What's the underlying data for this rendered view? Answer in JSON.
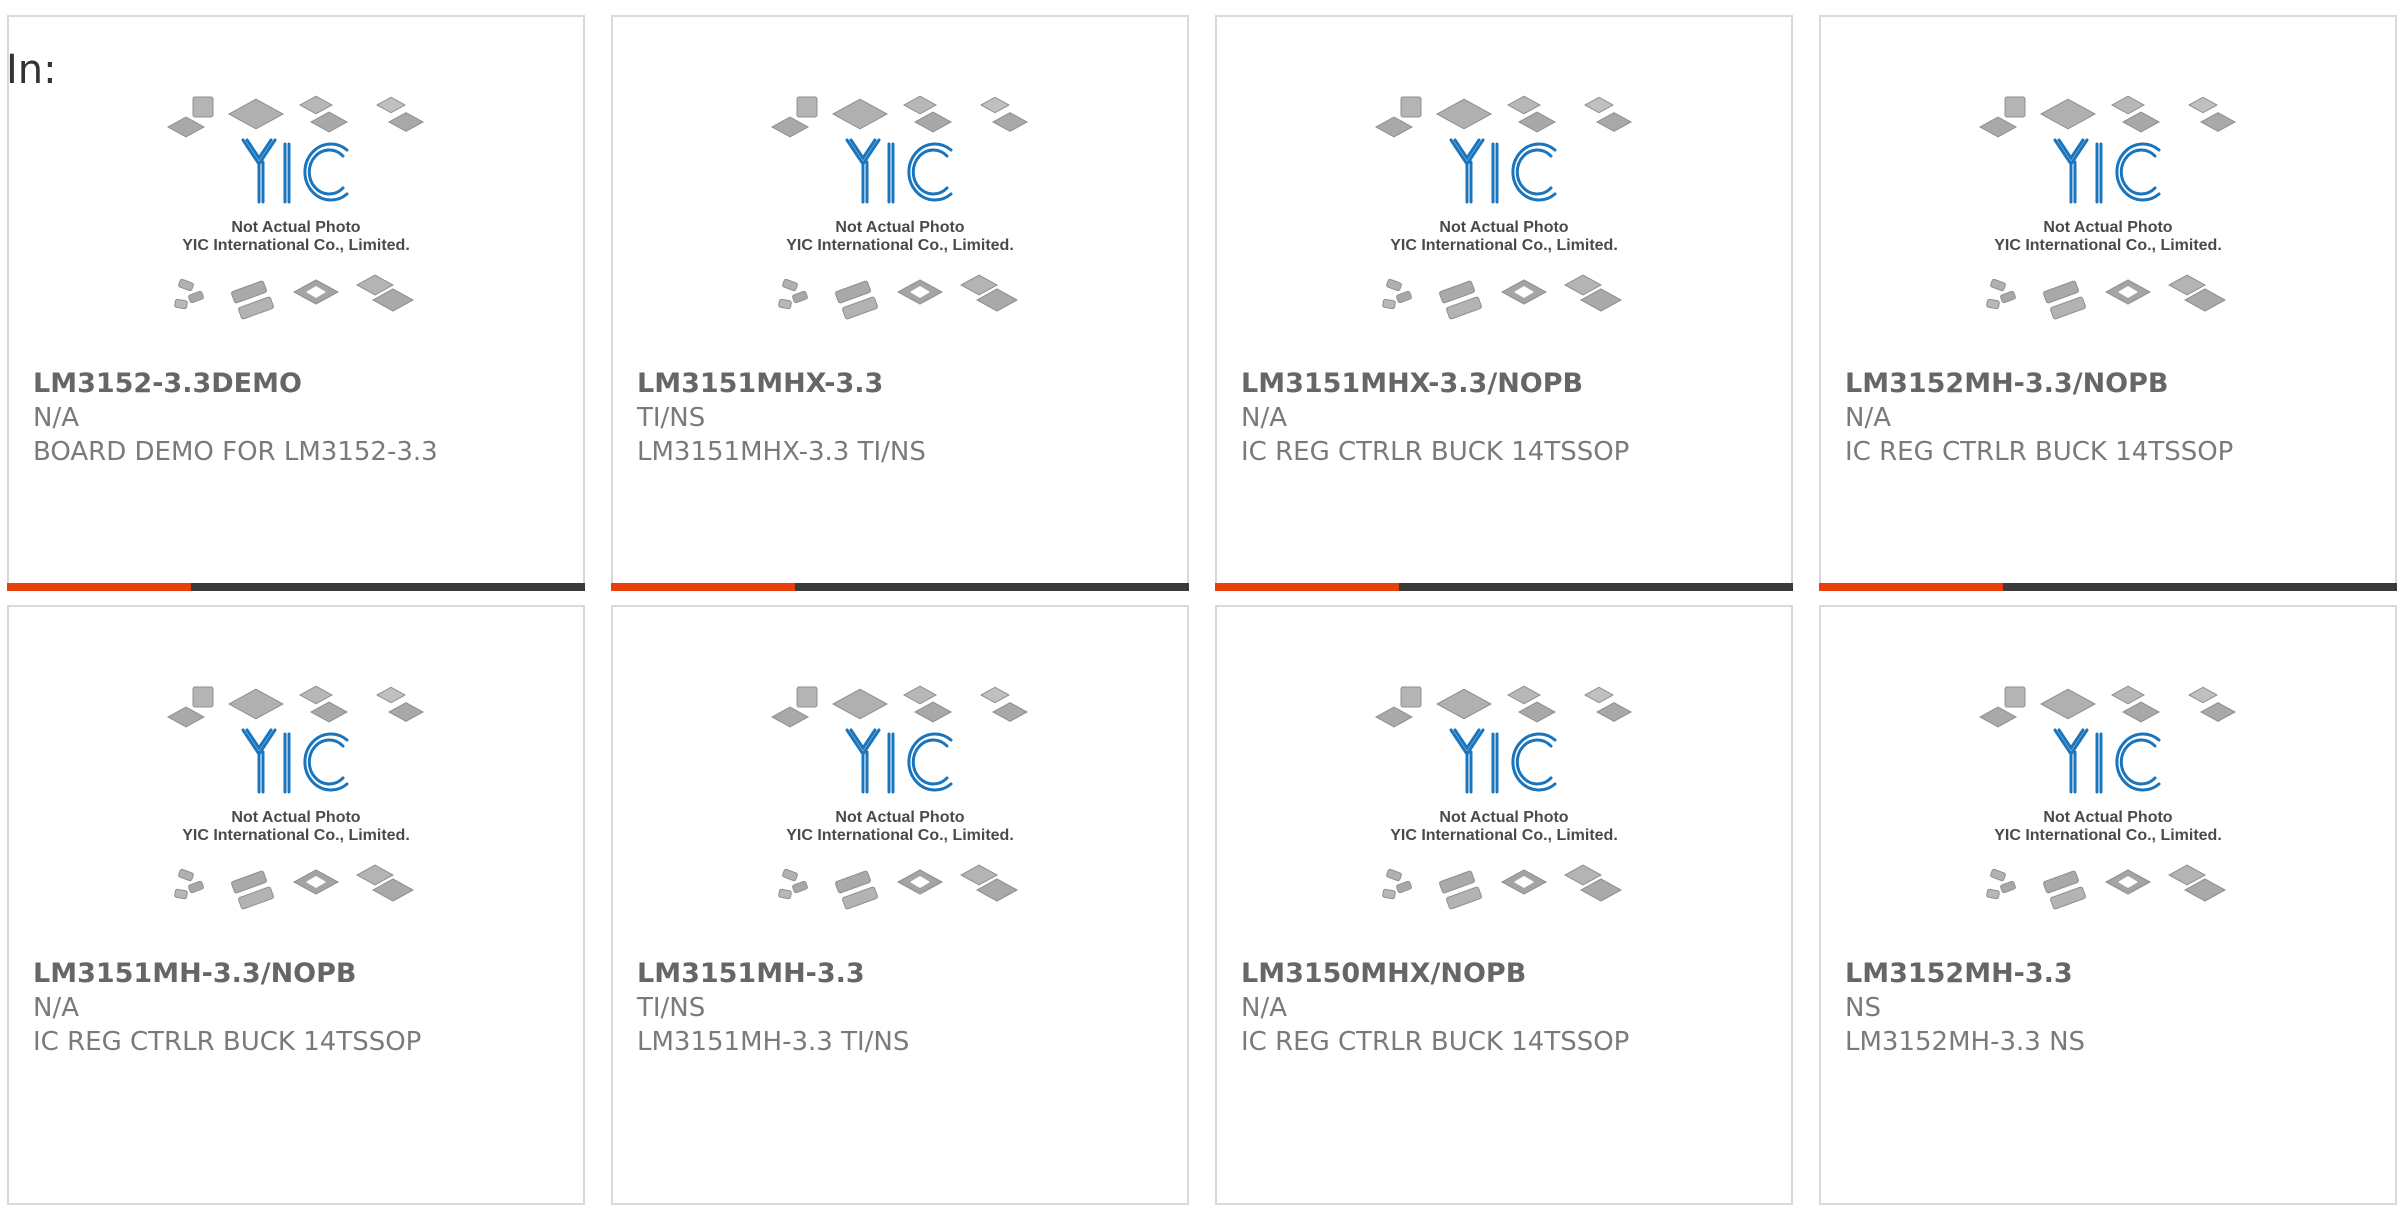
{
  "page": {
    "in_label": "In:"
  },
  "colors": {
    "accent": "#e8400c",
    "bar_dark": "#3a3a3a",
    "border": "#d9d9d9",
    "logo_blue": "#1b75bc"
  },
  "thumbnail": {
    "line1": "Not Actual Photo",
    "line2": "YIC International Co., Limited.",
    "logo_text": "YIC"
  },
  "products": [
    {
      "part": "LM3152-3.3DEMO",
      "manufacturer": "N/A",
      "description": "BOARD DEMO FOR LM3152-3.3"
    },
    {
      "part": "LM3151MHX-3.3",
      "manufacturer": "TI/NS",
      "description": "LM3151MHX-3.3 TI/NS"
    },
    {
      "part": "LM3151MHX-3.3/NOPB",
      "manufacturer": "N/A",
      "description": "IC REG CTRLR BUCK 14TSSOP"
    },
    {
      "part": "LM3152MH-3.3/NOPB",
      "manufacturer": "N/A",
      "description": "IC REG CTRLR BUCK 14TSSOP"
    },
    {
      "part": "LM3151MH-3.3/NOPB",
      "manufacturer": "N/A",
      "description": "IC REG CTRLR BUCK 14TSSOP"
    },
    {
      "part": "LM3151MH-3.3",
      "manufacturer": "TI/NS",
      "description": "LM3151MH-3.3 TI/NS"
    },
    {
      "part": "LM3150MHX/NOPB",
      "manufacturer": "N/A",
      "description": "IC REG CTRLR BUCK 14TSSOP"
    },
    {
      "part": "LM3152MH-3.3",
      "manufacturer": "NS",
      "description": "LM3152MH-3.3 NS"
    }
  ]
}
